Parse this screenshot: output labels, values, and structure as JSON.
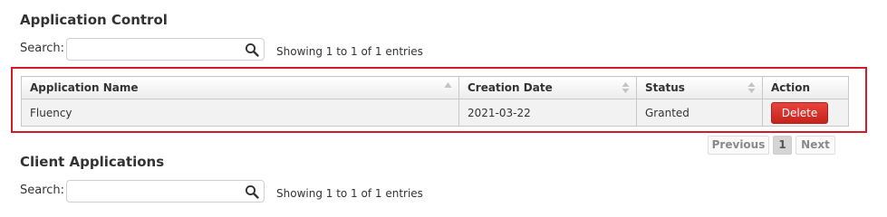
{
  "sections": {
    "app_control": {
      "title": "Application Control",
      "search_label": "Search:",
      "search_value": "",
      "showing": "Showing 1 to 1 of 1 entries",
      "columns": [
        "Application Name",
        "Creation Date",
        "Status",
        "Action"
      ],
      "rows": [
        {
          "name": "Fluency",
          "date": "2021-03-22",
          "status": "Granted",
          "action": "Delete"
        }
      ],
      "pagination": {
        "previous": "Previous",
        "page": "1",
        "next": "Next"
      }
    },
    "client_apps": {
      "title": "Client Applications",
      "search_label": "Search:",
      "search_value": "",
      "showing": "Showing 1 to 1 of 1 entries"
    }
  },
  "icons": {
    "search": "magnifier-icon",
    "sort": "sort-arrows-icon"
  },
  "colors": {
    "highlight_border": "#d11a2a",
    "delete_button": "#d9342d"
  }
}
